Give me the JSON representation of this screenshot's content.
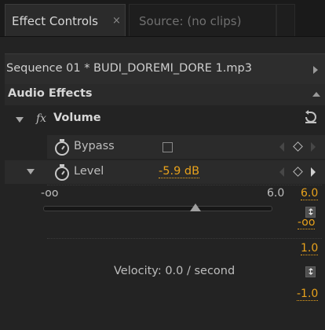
{
  "tabs": [
    {
      "label": "Effect Controls",
      "close": "×",
      "active": true
    },
    {
      "label": "Source: (no clips)",
      "active": false
    }
  ],
  "sequence_label": "Sequence 01 * BUDI_DOREMI_DORE 1.mp3",
  "section_title": "Audio Effects",
  "effect": {
    "fx_symbol": "fx",
    "name": "Volume"
  },
  "bypass": {
    "label": "Bypass",
    "checked": false
  },
  "level": {
    "label": "Level",
    "value": "-5.9 dB"
  },
  "level_slider": {
    "max_top": "6.0",
    "min_label": "-oo",
    "max_label": "6.0",
    "min_bottom": "-oo",
    "position_fraction": 0.67
  },
  "velocity": {
    "top": "1.0",
    "label": "Velocity: 0.0 / second",
    "bottom": "-1.0"
  },
  "colors": {
    "accent": "#e8a21c",
    "panel_bg": "#232323"
  },
  "icons": {
    "reset": "reset-icon",
    "stopwatch": "stopwatch-icon"
  }
}
